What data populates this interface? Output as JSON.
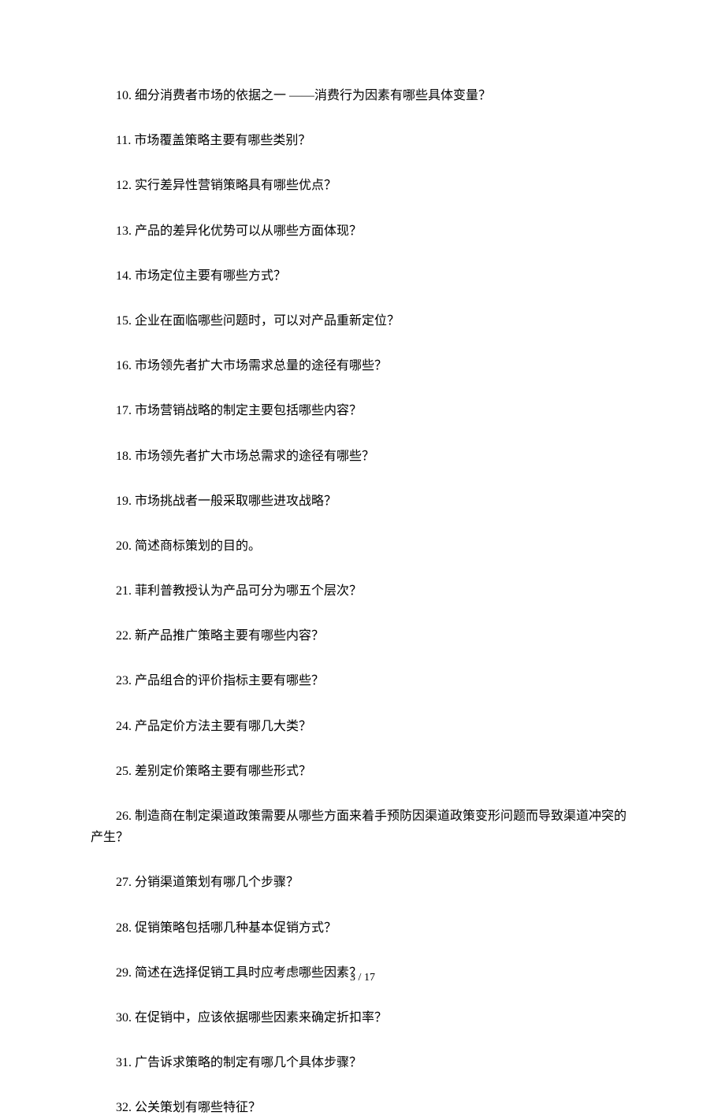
{
  "questions": [
    {
      "num": "10.",
      "text": "细分消费者市场的依据之一 ——消费行为因素有哪些具体变量？"
    },
    {
      "num": "11.",
      "text": "市场覆盖策略主要有哪些类别？"
    },
    {
      "num": "12.",
      "text": "实行差异性营销策略具有哪些优点？"
    },
    {
      "num": "13.",
      "text": "产品的差异化优势可以从哪些方面体现？"
    },
    {
      "num": "14.",
      "text": "市场定位主要有哪些方式？"
    },
    {
      "num": "15.",
      "text": "企业在面临哪些问题时，可以对产品重新定位？"
    },
    {
      "num": "16.",
      "text": "市场领先者扩大市场需求总量的途径有哪些？"
    },
    {
      "num": "17.",
      "text": "市场营销战略的制定主要包括哪些内容？"
    },
    {
      "num": "18.",
      "text": "市场领先者扩大市场总需求的途径有哪些？"
    },
    {
      "num": "19.",
      "text": "市场挑战者一般采取哪些进攻战略？"
    },
    {
      "num": "20.",
      "text": "简述商标策划的目的。"
    },
    {
      "num": "21.",
      "text": "菲利普教授认为产品可分为哪五个层次？"
    },
    {
      "num": "22.",
      "text": "新产品推广策略主要有哪些内容？"
    },
    {
      "num": "23.",
      "text": "产品组合的评价指标主要有哪些？"
    },
    {
      "num": "24.",
      "text": "产品定价方法主要有哪几大类？"
    },
    {
      "num": "25.",
      "text": "差别定价策略主要有哪些形式？"
    },
    {
      "num": "26.",
      "text": "制造商在制定渠道政策需要从哪些方面来着手预防因渠道政策变形问题而导致渠道冲突的产生？",
      "multi": true
    },
    {
      "num": "27.",
      "text": "分销渠道策划有哪几个步骤？"
    },
    {
      "num": "28.",
      "text": "促销策略包括哪几种基本促销方式？"
    },
    {
      "num": "29.",
      "text": "简述在选择促销工具时应考虑哪些因素？"
    },
    {
      "num": "30.",
      "text": "在促销中，应该依据哪些因素来确定折扣率？"
    },
    {
      "num": "31.",
      "text": "广告诉求策略的制定有哪几个具体步骤？"
    },
    {
      "num": "32.",
      "text": "公关策划有哪些特征？"
    }
  ],
  "footer": {
    "page_current": "3",
    "separator": " / ",
    "page_total": "17"
  }
}
